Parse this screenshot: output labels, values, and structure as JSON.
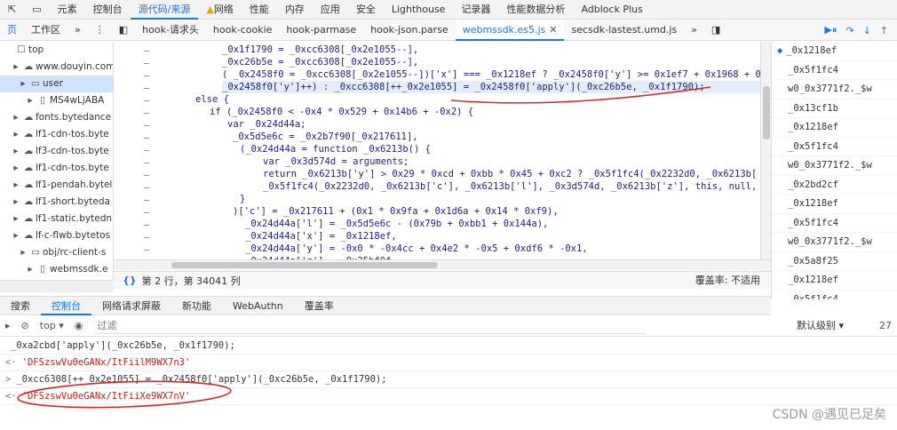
{
  "topbar": {
    "tabs": [
      "元素",
      "控制台",
      "源代码/来源",
      "网络",
      "性能",
      "内存",
      "应用",
      "安全",
      "Lighthouse",
      "记录器",
      "性能数据分析",
      "Adblock Plus"
    ],
    "active_index": 2
  },
  "editor_tabs": {
    "left": [
      "页",
      "工作区",
      "»"
    ],
    "files": [
      "hook-请求头",
      "hook-cookie",
      "hook-parmase",
      "hook-json.parse",
      "webmssdk.es5.js",
      "secsdk-lastest.umd.js"
    ],
    "active_index": 4,
    "more": "»"
  },
  "tree": [
    {
      "label": "top",
      "icon": "window-icon",
      "indent": 0,
      "selected": false
    },
    {
      "label": "www.douyin.com",
      "icon": "cloud-icon",
      "indent": 1,
      "selected": false
    },
    {
      "label": "user",
      "icon": "folder-icon",
      "indent": 2,
      "selected": true
    },
    {
      "label": "MS4wLjABA",
      "icon": "file-icon",
      "indent": 3,
      "selected": false
    },
    {
      "label": "fonts.bytedance",
      "icon": "cloud-icon",
      "indent": 1,
      "selected": false
    },
    {
      "label": "lf1-cdn-tos.byte",
      "icon": "cloud-icon",
      "indent": 1,
      "selected": false
    },
    {
      "label": "lf3-cdn-tos.byte",
      "icon": "cloud-icon",
      "indent": 1,
      "selected": false
    },
    {
      "label": "lf1-cdn-tos.byte",
      "icon": "cloud-icon",
      "indent": 1,
      "selected": false
    },
    {
      "label": "lf1-pendah.bytel",
      "icon": "cloud-icon",
      "indent": 1,
      "selected": false
    },
    {
      "label": "lf1-short.bytedа",
      "icon": "cloud-icon",
      "indent": 1,
      "selected": false
    },
    {
      "label": "lf1-static.bytedn",
      "icon": "cloud-icon",
      "indent": 1,
      "selected": false
    },
    {
      "label": "lf-c-flwb.bytetos",
      "icon": "cloud-icon",
      "indent": 1,
      "selected": false
    },
    {
      "label": "obj/rc-client-s",
      "icon": "folder-icon",
      "indent": 2,
      "selected": false
    },
    {
      "label": "webmssdk.e",
      "icon": "file-icon",
      "indent": 3,
      "selected": false
    }
  ],
  "code_lines": [
    "_0x1f1790 = _0xcc6308[_0x2e1055--],",
    "_0xc26b5e = _0xcc6308[_0x2e1055--],",
    "( _0x2458f0 = _0xcc6308[_0x2e1055--])['x'] === _0x1218ef ? _0x2458f0['y'] >= 0x1ef7 + 0x1968 + 0x2",
    "_0x2458f0['y']++) : _0xcc6308[++_0x2e1055] = _0x2458f0['apply'](_0xc26b5e, _0x1f1790);",
    "else {",
    "if (_0x2458f0 < -0x4 * 0x529 + 0x14b6 + -0x2) {",
    "var _0x24d44a;",
    "_0x5d5e6c = _0x2b7f90[_0x217611],",
    "(_0x24d44a = function _0x6213b() {",
    "var _0x3d574d = arguments;",
    "return _0x6213b['y'] > 0x29 * 0xcd + 0xbb * 0x45 + 0xc2 ? _0x5f1fc4(_0x2232d0, _0x6213b[",
    "_0x5f1fc4(_0x2232d0, _0x6213b['c'], _0x6213b['l'], _0x3d574d, _0x6213b['z'], this, null,",
    "}",
    ")['c'] = _0x217611 + (0x1 * 0x9fa + 0x1d6a + 0x14 * 0xf9),",
    "_0x24d44a['l'] = _0x5d5e6c - (0x79b + 0xbb1 + 0x144a),",
    "_0x24d44a['x'] = _0x1218ef,",
    "_0x24d44a['y'] = -0x0 * -0x4cc + 0x4e2 * -0x5 + 0xdf6 * -0x1,",
    "_0x24d44a['z'] = _0x25bf0f"
  ],
  "status": {
    "position": "第 2 行，第 34041 列",
    "coverage": "覆盖率: 不适用"
  },
  "call_stack": [
    "_0x1218ef",
    "_0x5f1fc4",
    "w0_0x3771f2._$w",
    "_0x13cf1b",
    "_0x1218ef",
    "_0x5f1fc4",
    "w0_0x3771f2._$w",
    "_0x2bd2cf",
    "_0x1218ef",
    "_0x5f1fc4",
    "w0_0x3771f2._$w",
    "_0x5a8f25",
    "_0x1218ef",
    "_0x5f1fc4"
  ],
  "drawer_tabs": [
    "搜索",
    "控制台",
    "网络请求屏蔽",
    "新功能",
    "WebAuthn",
    "覆盖率"
  ],
  "drawer_active": 1,
  "console_toolbar": {
    "context": "top ▾",
    "filter_placeholder": "过滤",
    "levels": "默认级别 ▾",
    "issues": "27"
  },
  "console_rows": [
    {
      "prefix": "",
      "text": "_0xa2cbd['apply'](_0xc26b5e, _0x1f1790);",
      "type": "code"
    },
    {
      "prefix": "<·",
      "text": "'DFSzswVu0eGANx/ItFiilM9WX7n3'",
      "type": "result"
    },
    {
      "prefix": ">",
      "text": "_0xcc6308[++_0x2e1055] = _0x2458f0['apply'](_0xc26b5e, _0x1f1790);",
      "type": "code"
    },
    {
      "prefix": "<·",
      "text": "'DFSzswVu0eGANx/ItFiiXe9WX7nV'",
      "type": "result"
    }
  ],
  "watermark": "CSDN @遇见已足矣"
}
